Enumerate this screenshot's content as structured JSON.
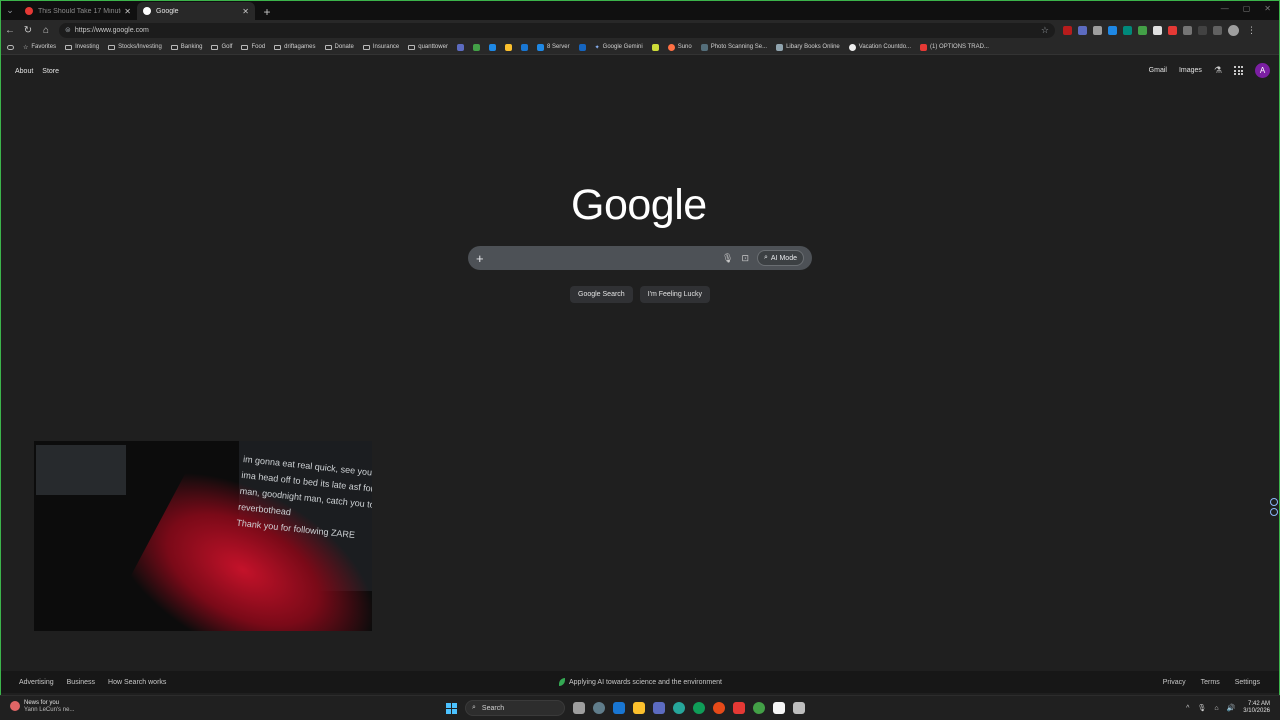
{
  "browser": {
    "tabs": [
      {
        "title": "This Should Take 17 Minutes. It T...",
        "active": false,
        "favicon_color": "#e53935"
      },
      {
        "title": "Google",
        "active": true,
        "favicon_color": "#ffffff"
      }
    ],
    "url": "https://www.google.com",
    "bookmarks": [
      {
        "label": "Favorites",
        "type": "star"
      },
      {
        "label": "Investing",
        "type": "folder"
      },
      {
        "label": "Stocks/Investing",
        "type": "folder"
      },
      {
        "label": "Banking",
        "type": "folder"
      },
      {
        "label": "Golf",
        "type": "folder"
      },
      {
        "label": "Food",
        "type": "folder"
      },
      {
        "label": "driftagames",
        "type": "folder"
      },
      {
        "label": "Donate",
        "type": "folder"
      },
      {
        "label": "Insurance",
        "type": "folder"
      },
      {
        "label": "quanttower",
        "type": "folder"
      },
      {
        "label": "8 Server",
        "type": "site"
      },
      {
        "label": "Google Gemini",
        "type": "site"
      },
      {
        "label": "Suno",
        "type": "site"
      },
      {
        "label": "Photo Scanning Se...",
        "type": "site"
      },
      {
        "label": "Libary Books Online",
        "type": "site"
      },
      {
        "label": "Vacation Countdo...",
        "type": "site"
      },
      {
        "label": "(1) OPTIONS TRAD...",
        "type": "site"
      }
    ]
  },
  "google": {
    "nav_left": [
      "About",
      "Store"
    ],
    "nav_right": [
      "Gmail",
      "Images"
    ],
    "avatar_letter": "A",
    "logo": "Google",
    "ai_mode_label": "AI Mode",
    "search_button": "Google Search",
    "lucky_button": "I'm Feeling Lucky",
    "footer_left": [
      "Advertising",
      "Business",
      "How Search works"
    ],
    "footer_center": "Applying AI towards science and the environment",
    "footer_right": [
      "Privacy",
      "Terms",
      "Settings"
    ]
  },
  "webcam": {
    "chat_lines": [
      "im gonna eat real quick, see you",
      "ima head off to bed its late asf for",
      "man, goodnight man, catch you tomorrow",
      "reverbothead",
      "Thank you for following ZARE"
    ]
  },
  "taskbar": {
    "news_title": "News for you",
    "news_sub": "Yann LeCun's ne...",
    "search_label": "Search",
    "time": "7:42 AM",
    "date": "3/10/2026"
  },
  "colors": {
    "page_bg": "#1f1f1f",
    "search_bg": "#4d5156",
    "avatar": "#7b1fa2",
    "accent_green": "#3cb44b"
  }
}
